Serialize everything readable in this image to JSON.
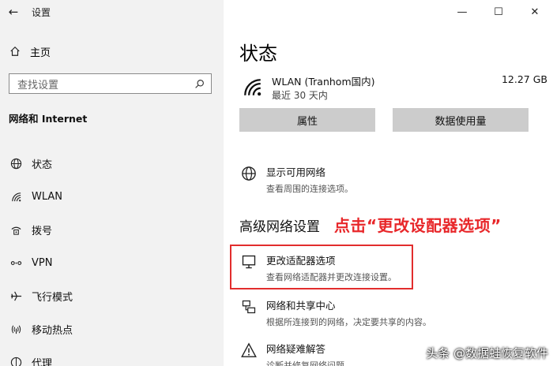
{
  "app": {
    "title": "设置",
    "back_icon": "back-arrow-icon",
    "window_controls": {
      "minimize": "—",
      "maximize": "☐",
      "close": "✕"
    }
  },
  "sidebar": {
    "home_label": "主页",
    "search_placeholder": "查找设置",
    "section_title": "网络和 Internet",
    "items": [
      {
        "label": "状态",
        "icon": "globe-icon"
      },
      {
        "label": "WLAN",
        "icon": "wifi-icon"
      },
      {
        "label": "拨号",
        "icon": "dialup-icon"
      },
      {
        "label": "VPN",
        "icon": "vpn-icon"
      },
      {
        "label": "飞行模式",
        "icon": "airplane-icon"
      },
      {
        "label": "移动热点",
        "icon": "hotspot-icon"
      },
      {
        "label": "代理",
        "icon": "proxy-icon"
      }
    ]
  },
  "main": {
    "page_title": "状态",
    "network": {
      "name": "WLAN (Tranhom国内)",
      "subtitle": "最近 30 天内",
      "usage": "12.27 GB"
    },
    "buttons": {
      "properties": "属性",
      "data_usage": "数据使用量"
    },
    "show_networks": {
      "title": "显示可用网络",
      "desc": "查看周围的连接选项。"
    },
    "advanced_title": "高级网络设置",
    "callout": "点击“更改设配器选项”",
    "adapter_options": {
      "title": "更改适配器选项",
      "desc": "查看网络适配器并更改连接设置。"
    },
    "sharing_center": {
      "title": "网络和共享中心",
      "desc": "根据所连接到的网络，决定要共享的内容。"
    },
    "troubleshooter": {
      "title": "网络疑难解答",
      "desc": "诊断并修复网络问题。"
    }
  },
  "watermark": "头条 @数据蛙恢复软件",
  "colors": {
    "sidebar_bg": "#f2f2f2",
    "button_bg": "#cccccc",
    "highlight": "#e22d2d",
    "callout": "#e8272a"
  }
}
